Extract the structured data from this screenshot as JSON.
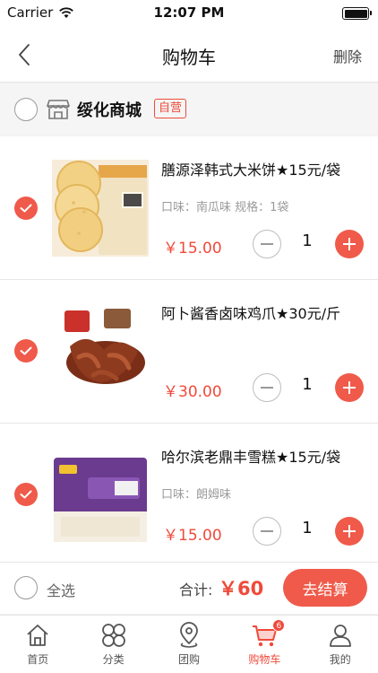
{
  "status_bar": {
    "carrier": "Carrier",
    "time": "12:07 PM"
  },
  "nav": {
    "title": "购物车",
    "delete_label": "删除"
  },
  "store": {
    "name": "绥化商城",
    "tag": "自营"
  },
  "items": [
    {
      "title": "膳源泽韩式大米饼★15元/袋",
      "spec": "口味：南瓜味 规格：1袋",
      "price": "￥15.00",
      "quantity": "1",
      "checked": true
    },
    {
      "title": "阿卜酱香卤味鸡爪★30元/斤",
      "spec": "",
      "price": "￥30.00",
      "quantity": "1",
      "checked": true
    },
    {
      "title": "哈尔滨老鼎丰雪糕★15元/袋",
      "spec": "口味：朗姆味",
      "price": "￥15.00",
      "quantity": "1",
      "checked": true
    }
  ],
  "checkout": {
    "select_all_label": "全选",
    "total_label": "合计:",
    "total_amount": "￥60",
    "button_label": "去结算"
  },
  "tabs": [
    {
      "label": "首页",
      "icon": "home-icon"
    },
    {
      "label": "分类",
      "icon": "category-icon"
    },
    {
      "label": "团购",
      "icon": "location-pin-icon"
    },
    {
      "label": "购物车",
      "icon": "cart-icon",
      "badge": "6",
      "active": true
    },
    {
      "label": "我的",
      "icon": "user-icon"
    }
  ],
  "colors": {
    "accent": "#ef5a4a",
    "price": "#ef4a3a",
    "background": "#f2f2f2"
  }
}
